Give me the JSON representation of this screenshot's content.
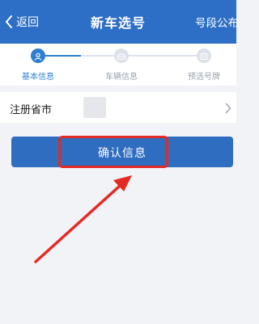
{
  "header": {
    "back_label": "返回",
    "title": "新车选号",
    "right_link": "号段公布"
  },
  "stepper": {
    "steps": [
      {
        "label": "基本信息",
        "state": "active",
        "icon": "user-icon"
      },
      {
        "label": "车辆信息",
        "state": "inactive",
        "icon": "car-icon"
      },
      {
        "label": "预选号牌",
        "state": "inactive",
        "icon": "license-plate-icon"
      }
    ]
  },
  "form": {
    "province_label": "注册省市",
    "province_value": ""
  },
  "confirm_button": {
    "label": "确认信息"
  },
  "colors": {
    "header_bg": "#2d6fc6",
    "accent": "#2d7fd0",
    "button_bg": "#2e6dbf",
    "annotation": "#e42a25",
    "page_bg": "#f2f3f7"
  }
}
